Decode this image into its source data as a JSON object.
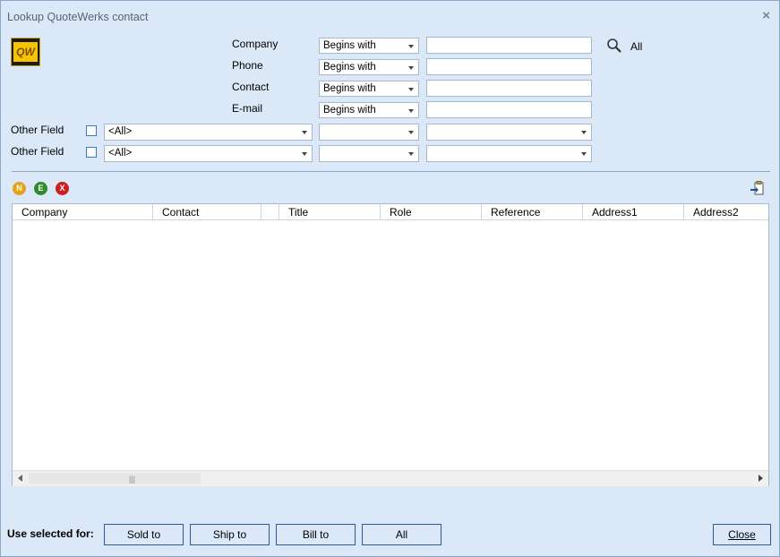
{
  "window": {
    "title": "Lookup QuoteWerks contact",
    "close_glyph": "×"
  },
  "logo": {
    "text": "QW"
  },
  "filters": [
    {
      "label": "Company",
      "operator": "Begins with",
      "value": ""
    },
    {
      "label": "Phone",
      "operator": "Begins with",
      "value": ""
    },
    {
      "label": "Contact",
      "operator": "Begins with",
      "value": ""
    },
    {
      "label": "E-mail",
      "operator": "Begins with",
      "value": ""
    }
  ],
  "search": {
    "label": "All",
    "icon": "magnifier-icon"
  },
  "other_fields": [
    {
      "label": "Other Field",
      "checked": false,
      "field": "<All>",
      "operator": "",
      "value": ""
    },
    {
      "label": "Other Field",
      "checked": false,
      "field": "<All>",
      "operator": "",
      "value": ""
    }
  ],
  "toolbar": {
    "new_label": "N",
    "new_color": "#e6a117",
    "edit_label": "E",
    "edit_color": "#2e8b2e",
    "delete_label": "X",
    "delete_color": "#cc1f1f",
    "export_icon": "clipboard-arrow-icon"
  },
  "grid": {
    "columns": [
      "Company",
      "Contact",
      "",
      "Title",
      "Role",
      "Reference",
      "Address1",
      "Address2"
    ],
    "rows": []
  },
  "footer": {
    "use_label": "Use selected for:",
    "buttons": [
      "Sold to",
      "Ship to",
      "Bill to",
      "All"
    ],
    "close_label": "Close"
  }
}
